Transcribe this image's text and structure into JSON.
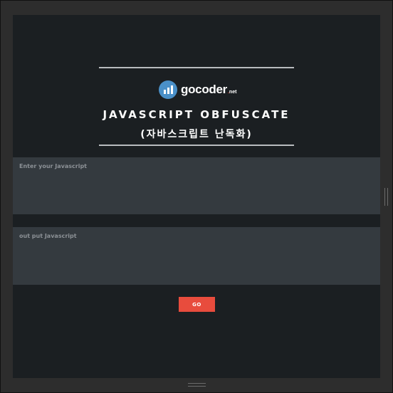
{
  "logo": {
    "name": "gocoder",
    "tld_dot": ".",
    "tld": "net",
    "icon": "bar-chart-icon"
  },
  "header": {
    "title": "JAVASCRIPT OBFUSCATE",
    "subtitle": "(자바스크립트 난독화)"
  },
  "input": {
    "placeholder": "Enter your Javascript",
    "value": ""
  },
  "output": {
    "placeholder": "out put Javascript",
    "value": ""
  },
  "actions": {
    "go_label": "GO"
  },
  "colors": {
    "panel_bg": "#1b1f22",
    "textarea_bg": "#343a3f",
    "accent": "#e84c3d",
    "logo_blue": "#4a90c8"
  }
}
